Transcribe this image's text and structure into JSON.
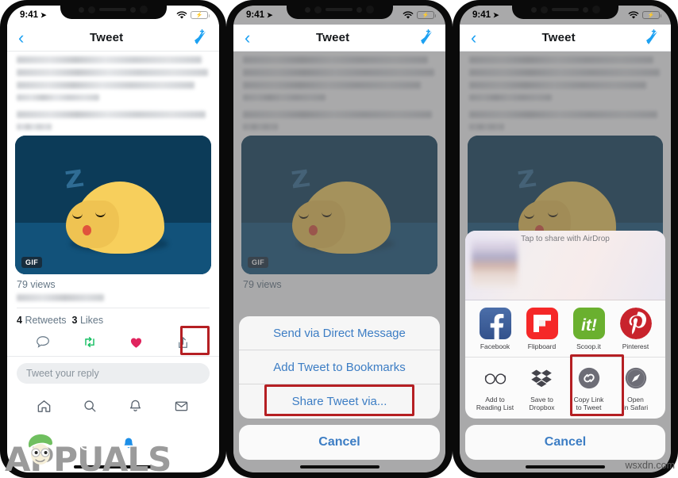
{
  "meta": {
    "watermark_brand": "APPUALS",
    "watermark_site": "wsxdn.com"
  },
  "status_bar": {
    "time": "9:41",
    "location_icon": "location-arrow-icon",
    "wifi_icon": "wifi-icon",
    "battery_icon": "battery-charging-icon"
  },
  "nav": {
    "back_icon": "chevron-left-icon",
    "title": "Tweet",
    "compose_icon": "compose-tweet-icon"
  },
  "tweet": {
    "gif_badge": "GIF",
    "views": "79 views",
    "retweets_count": "4",
    "retweets_label": "Retweets",
    "likes_count": "3",
    "likes_label": "Likes",
    "reply_placeholder": "Tweet your reply",
    "actions": [
      {
        "name": "reply-icon",
        "glyph": "reply"
      },
      {
        "name": "retweet-icon",
        "glyph": "retweet"
      },
      {
        "name": "like-icon",
        "glyph": "heart"
      },
      {
        "name": "share-icon",
        "glyph": "share-up"
      }
    ]
  },
  "tabbar": {
    "items": [
      {
        "name": "tab-home",
        "glyph": "home"
      },
      {
        "name": "tab-search",
        "glyph": "search"
      },
      {
        "name": "tab-notifications",
        "glyph": "bell"
      },
      {
        "name": "tab-messages",
        "glyph": "envelope"
      }
    ]
  },
  "phone1": {
    "highlight_target": "share-icon"
  },
  "phone2": {
    "action_sheet": {
      "items": [
        "Send via Direct Message",
        "Add Tweet to Bookmarks",
        "Share Tweet via..."
      ],
      "highlighted_index": 2,
      "cancel": "Cancel"
    }
  },
  "phone3": {
    "share_sheet": {
      "airdrop_label": "Tap to share with AirDrop",
      "apps": [
        {
          "label": "Facebook",
          "icon": "facebook-icon",
          "color": "#3b5998"
        },
        {
          "label": "Flipboard",
          "icon": "flipboard-icon",
          "color": "#f52828"
        },
        {
          "label": "Scoop.it",
          "icon": "scoopit-icon",
          "color": "#6ab02f"
        },
        {
          "label": "Pinterest",
          "icon": "pinterest-icon",
          "color": "#c8232c"
        }
      ],
      "actions": [
        {
          "label": "Add to\nReading List",
          "line1": "Add to",
          "line2": "Reading List",
          "icon": "glasses-icon"
        },
        {
          "label": "Save to\nDropbox",
          "line1": "Save to",
          "line2": "Dropbox",
          "icon": "dropbox-icon"
        },
        {
          "label": "Copy Link\nto Tweet",
          "line1": "Copy Link",
          "line2": "to Tweet",
          "icon": "link-icon"
        },
        {
          "label": "Open\nin Safari",
          "line1": "Open",
          "line2": "in Safari",
          "icon": "safari-icon"
        }
      ],
      "highlighted_action_index": 2,
      "cancel": "Cancel"
    }
  },
  "colors": {
    "twitter_blue": "#1da1f2",
    "ios_blue": "#3c7dc4",
    "highlight_red": "#b51f23",
    "like_red": "#e0245e",
    "retweet_green": "#17bf63",
    "gif_bg": "#0c3b58",
    "blob_yellow": "#f7cf5c"
  }
}
